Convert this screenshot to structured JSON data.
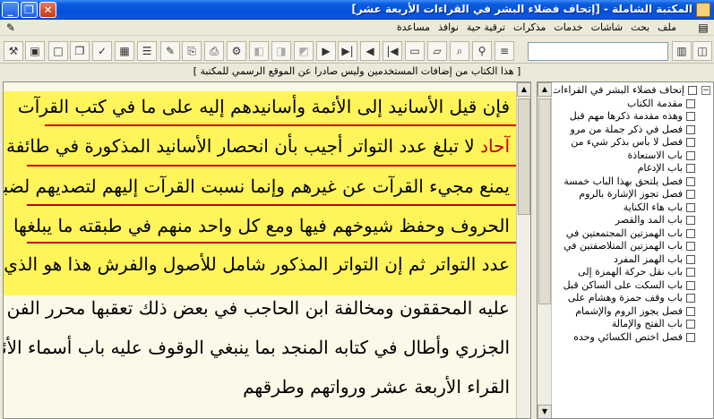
{
  "window": {
    "title": "المكتبة الشاملة - [إتحاف فضلاء البشر في القراءات الأربعة عشر]",
    "controls": {
      "minimize": "_",
      "restore": "❐",
      "close": "✕"
    }
  },
  "menubar": {
    "items": [
      "ملف",
      "بحث",
      "شاشات",
      "خدمات",
      "مذكرات",
      "ترقية حية",
      "نوافذ",
      "مساعدة"
    ]
  },
  "notice": "[ هذا الكتاب من إضافات المستخدمين وليس صادرا عن الموقع الرسمي للمكتبة ]",
  "toolbar": {
    "search_value": "",
    "icons": [
      "tools-icon",
      "display-icon",
      "font-icon",
      "new-icon",
      "copy-icon",
      "check-icon",
      "save-icon",
      "notes-icon",
      "tree-icon",
      "export-icon",
      "book-icon",
      "print-icon",
      "settings-icon",
      "disabled-icon-1",
      "disabled-icon-2",
      "disabled-icon-3",
      "next-icon",
      "last-icon",
      "prev-icon",
      "first-icon",
      "page-icon",
      "open-icon",
      "find-icon",
      "highlight-icon",
      "menu-icon",
      "book-open-icon",
      "library-icon"
    ]
  },
  "main_text": {
    "lines": [
      "فإن قيل الأسانيد إلى الأئمة وأسانيدهم إليه على ما في كتب القرآت",
      "لا تبلغ عدد التواتر أجيب بأن انحصار الأسانيد المذكورة في طائفة لا",
      "يمنع مجيء القرآت عن غيرهم وإنما نسبت القرآت إليهم لتصديهم لضبط",
      "الحروف وحفظ شيوخهم فيها ومع كل واحد منهم في طبقته ما يبلغها",
      "عدد التواتر ثم إن التواتر المذكور شامل للأصول والفرش هذا هو الذي",
      "عليه المحققون ومخالفة ابن الحاجب في بعض ذلك تعقبها محرر الفن ابن",
      "الجزري وأطال في كتابه المنجد بما ينبغي الوقوف عليه باب أسماء الأئمة",
      "القراء الأربعة عشر ورواتهم وطرقهم"
    ],
    "red_word": "آحاد"
  },
  "tree": {
    "root": "إتحاف فضلاء البشر في القراءات",
    "items": [
      "مقدمة الكتاب",
      "وهذه مقدمة ذكرها مهم قبل",
      "فصل في ذكر جملة من مرو",
      "فصل لا بأس بذكر شيء من",
      "باب الاستعاذة",
      "باب الإدغام",
      "فصل يلتحق بهذا الباب خمسة",
      "فصل تجوز الإشارة بالروم",
      "باب هاء الكناية",
      "باب المد والقصر",
      "باب الهمزتين المجتمعتين في",
      "باب الهمزتين المتلاصقتين في",
      "باب الهمز المفرد",
      "باب نقل حركة الهمزة إلى",
      "باب السكت على الساكن قبل",
      "باب وقف حمزة وهشام على",
      "فصل يجوز الروم والإشمام",
      "باب الفتح والإمالة",
      "فصل اختص الكسائي وحده"
    ]
  }
}
